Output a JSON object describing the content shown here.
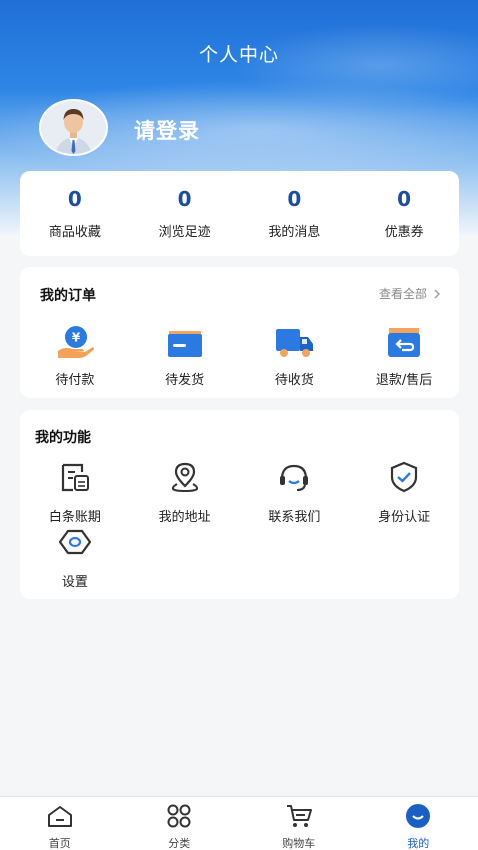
{
  "header": {
    "title": "个人中心"
  },
  "profile": {
    "login_text": "请登录"
  },
  "stats": [
    {
      "value": "0",
      "label": "商品收藏"
    },
    {
      "value": "0",
      "label": "浏览足迹"
    },
    {
      "value": "0",
      "label": "我的消息"
    },
    {
      "value": "0",
      "label": "优惠券"
    }
  ],
  "orders": {
    "title": "我的订单",
    "view_all": "查看全部",
    "items": [
      {
        "label": "待付款",
        "icon": "payment-icon"
      },
      {
        "label": "待发货",
        "icon": "ship-box-icon"
      },
      {
        "label": "待收货",
        "icon": "truck-icon"
      },
      {
        "label": "退款/售后",
        "icon": "refund-icon"
      }
    ]
  },
  "features": {
    "title": "我的功能",
    "items": [
      {
        "label": "白条账期",
        "icon": "credit-bill-icon"
      },
      {
        "label": "我的地址",
        "icon": "location-icon"
      },
      {
        "label": "联系我们",
        "icon": "headset-icon"
      },
      {
        "label": "身份认证",
        "icon": "shield-check-icon"
      },
      {
        "label": "设置",
        "icon": "settings-icon"
      }
    ]
  },
  "tabbar": {
    "items": [
      {
        "label": "首页",
        "icon": "home-icon"
      },
      {
        "label": "分类",
        "icon": "category-icon"
      },
      {
        "label": "购物车",
        "icon": "cart-icon"
      },
      {
        "label": "我的",
        "icon": "profile-icon"
      }
    ],
    "active_color": "#1a5fc4"
  },
  "colors": {
    "primary": "#1f6fd6",
    "stat_value": "#1a4fa0"
  }
}
